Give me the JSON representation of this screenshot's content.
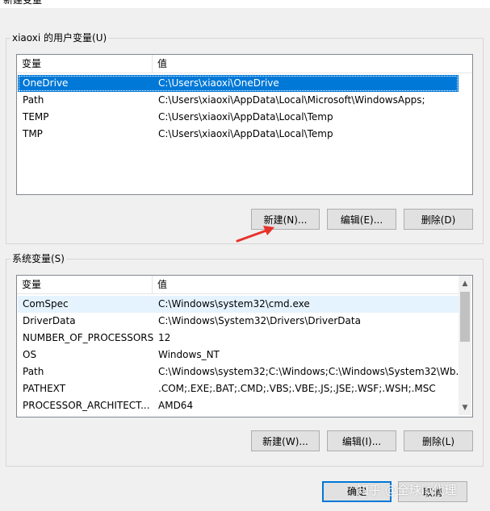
{
  "window": {
    "title": "新建变量"
  },
  "user_group": {
    "label": "xiaoxi 的用户变量(U)",
    "headers": [
      "变量",
      "值"
    ],
    "rows": [
      {
        "name": "OneDrive",
        "value": "C:\\Users\\xiaoxi\\OneDrive"
      },
      {
        "name": "Path",
        "value": "C:\\Users\\xiaoxi\\AppData\\Local\\Microsoft\\WindowsApps;"
      },
      {
        "name": "TEMP",
        "value": "C:\\Users\\xiaoxi\\AppData\\Local\\Temp"
      },
      {
        "name": "TMP",
        "value": "C:\\Users\\xiaoxi\\AppData\\Local\\Temp"
      }
    ],
    "buttons": {
      "new": "新建(N)...",
      "edit": "编辑(E)...",
      "delete": "删除(D)"
    }
  },
  "system_group": {
    "label": "系统变量(S)",
    "headers": [
      "变量",
      "值"
    ],
    "rows": [
      {
        "name": "ComSpec",
        "value": "C:\\Windows\\system32\\cmd.exe"
      },
      {
        "name": "DriverData",
        "value": "C:\\Windows\\System32\\Drivers\\DriverData"
      },
      {
        "name": "NUMBER_OF_PROCESSORS",
        "value": "12"
      },
      {
        "name": "OS",
        "value": "Windows_NT"
      },
      {
        "name": "Path",
        "value": "C:\\Windows\\system32;C:\\Windows;C:\\Windows\\System32\\Wb..."
      },
      {
        "name": "PATHEXT",
        "value": ".COM;.EXE;.BAT;.CMD;.VBS;.VBE;.JS;.JSE;.WSF;.WSH;.MSC"
      },
      {
        "name": "PROCESSOR_ARCHITECT...",
        "value": "AMD64"
      }
    ],
    "buttons": {
      "new": "新建(W)...",
      "edit": "编辑(I)...",
      "delete": "删除(L)"
    }
  },
  "footer": {
    "ok": "确定",
    "cancel": "取消"
  },
  "watermark": "知乎 @全球ip代理",
  "colors": {
    "selection": "#0078d7",
    "arrow": "#e8322a"
  }
}
